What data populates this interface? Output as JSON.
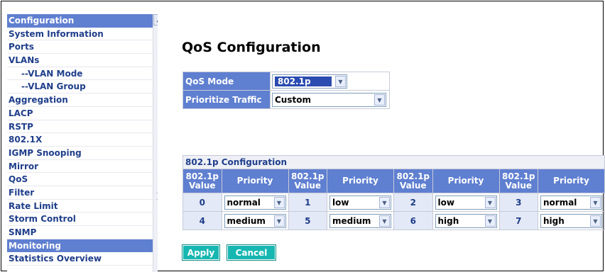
{
  "sidebar": {
    "items": [
      {
        "label": "Configuration",
        "type": "header"
      },
      {
        "label": "System Information",
        "type": "item"
      },
      {
        "label": "Ports",
        "type": "item"
      },
      {
        "label": "VLANs",
        "type": "item"
      },
      {
        "label": "--VLAN Mode",
        "type": "sub"
      },
      {
        "label": "--VLAN Group",
        "type": "sub"
      },
      {
        "label": "Aggregation",
        "type": "item"
      },
      {
        "label": "LACP",
        "type": "item"
      },
      {
        "label": "RSTP",
        "type": "item"
      },
      {
        "label": "802.1X",
        "type": "item"
      },
      {
        "label": "IGMP Snooping",
        "type": "item"
      },
      {
        "label": "Mirror",
        "type": "item"
      },
      {
        "label": "QoS",
        "type": "item"
      },
      {
        "label": "Filter",
        "type": "item"
      },
      {
        "label": "Rate Limit",
        "type": "item"
      },
      {
        "label": "Storm Control",
        "type": "item"
      },
      {
        "label": "SNMP",
        "type": "item"
      },
      {
        "label": "Monitoring",
        "type": "header"
      },
      {
        "label": "Statistics Overview",
        "type": "item"
      }
    ]
  },
  "main": {
    "title": "QoS Configuration",
    "qos_mode_label": "QoS Mode",
    "qos_mode_value": "802.1p",
    "prioritize_label": "Prioritize Traffic",
    "prioritize_value": "Custom"
  },
  "cfg": {
    "title": "802.1p Configuration",
    "col_value_line1": "802.1p",
    "col_value_line2": "Value",
    "col_priority": "Priority",
    "rows": [
      [
        {
          "value": "0",
          "priority": "normal"
        },
        {
          "value": "1",
          "priority": "low"
        },
        {
          "value": "2",
          "priority": "low"
        },
        {
          "value": "3",
          "priority": "normal"
        }
      ],
      [
        {
          "value": "4",
          "priority": "medium"
        },
        {
          "value": "5",
          "priority": "medium"
        },
        {
          "value": "6",
          "priority": "high"
        },
        {
          "value": "7",
          "priority": "high"
        }
      ]
    ]
  },
  "buttons": {
    "apply": "Apply",
    "cancel": "Cancel"
  },
  "colors": {
    "accent": "#5f7fd0",
    "button": "#16b7b1",
    "text_link": "#1f3e8a"
  }
}
